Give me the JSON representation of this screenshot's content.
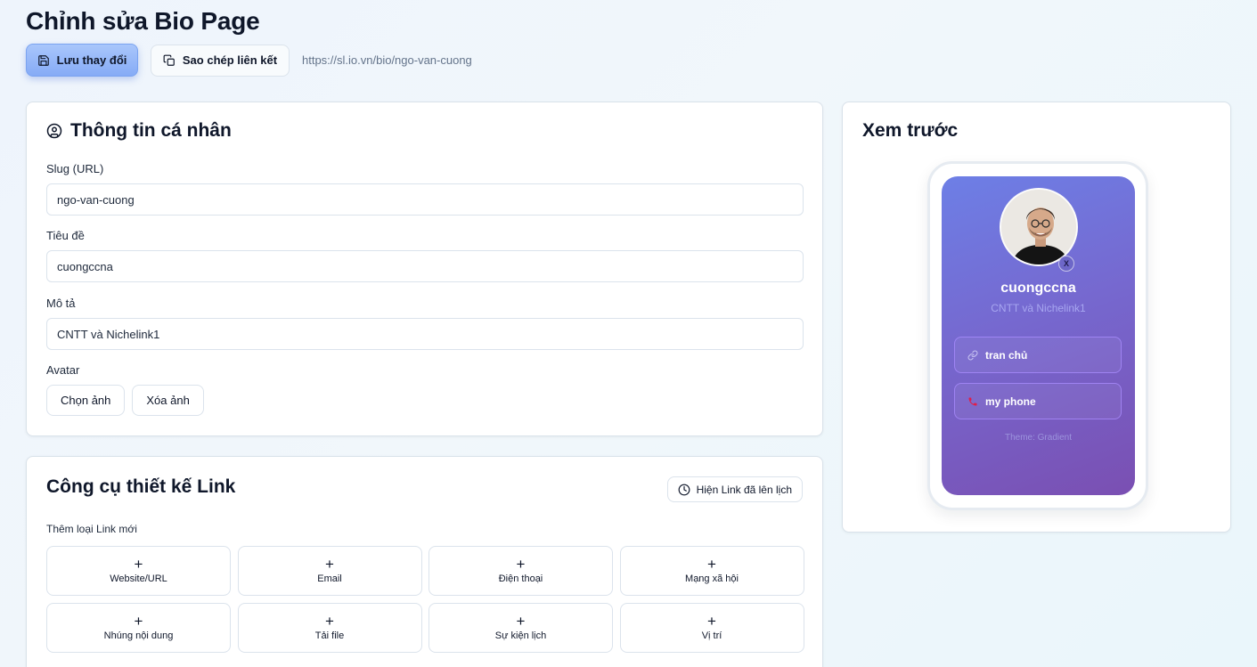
{
  "header": {
    "title": "Chỉnh sửa Bio Page",
    "save_label": "Lưu thay đổi",
    "copy_label": "Sao chép liên kết",
    "page_url": "https://sl.io.vn/bio/ngo-van-cuong"
  },
  "profile": {
    "section_title": "Thông tin cá nhân",
    "slug_label": "Slug (URL)",
    "slug_value": "ngo-van-cuong",
    "title_label": "Tiêu đề",
    "title_value": "cuongccna",
    "desc_label": "Mô tả",
    "desc_value": "CNTT và Nichelink1",
    "avatar_label": "Avatar",
    "choose_image": "Chọn ảnh",
    "remove_image": "Xóa ảnh"
  },
  "tools": {
    "section_title": "Công cụ thiết kế Link",
    "scheduled_label": "Hiện Link đã lên lịch",
    "add_label": "Thêm loại Link mới",
    "types": [
      {
        "label": "Website/URL"
      },
      {
        "label": "Email"
      },
      {
        "label": "Điện thoại"
      },
      {
        "label": "Mạng xã hội"
      },
      {
        "label": "Nhúng nội dung"
      },
      {
        "label": "Tải file"
      },
      {
        "label": "Sự kiện lịch"
      },
      {
        "label": "Vị trí"
      }
    ],
    "plus_symbol": "+"
  },
  "preview": {
    "section_title": "Xem trước",
    "name": "cuongccna",
    "description": "CNTT và Nichelink1",
    "remove_avatar": "X",
    "links": [
      {
        "label": "tran chủ",
        "icon": "link-icon"
      },
      {
        "label": "my phone",
        "icon": "phone-icon"
      }
    ],
    "theme_text": "Theme: Gradient"
  },
  "colors": {
    "primary_button": "#86abf6",
    "preview_gradient_start": "#6d7fe6",
    "preview_gradient_end": "#7a4fb2",
    "phone_icon": "#e11d48"
  }
}
